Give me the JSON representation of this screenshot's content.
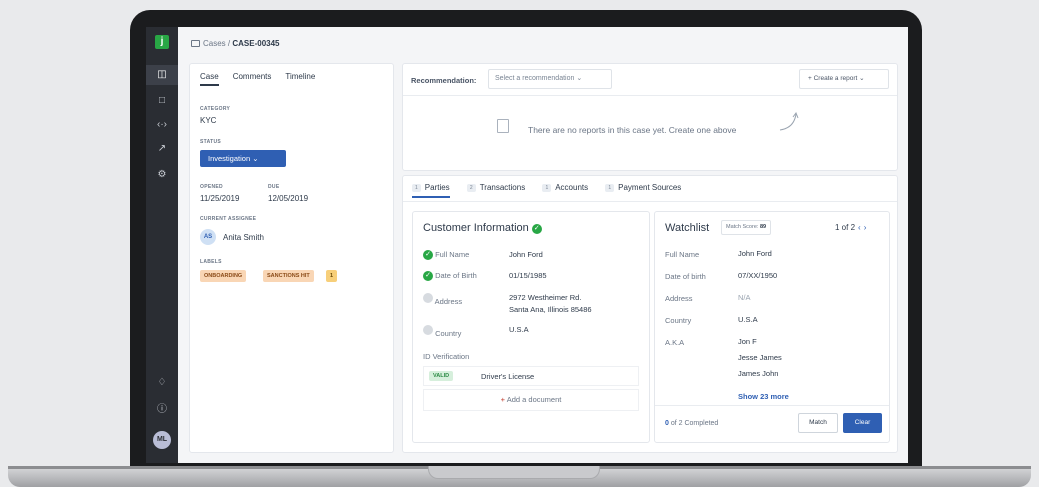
{
  "app": {
    "logo": "j",
    "breadcrumb_parent": "Cases",
    "breadcrumb_sep": " / ",
    "breadcrumb_current": "CASE-00345",
    "user_initials": "ML"
  },
  "left_panel": {
    "tabs": [
      "Case",
      "Comments",
      "Timeline"
    ],
    "category_label": "CATEGORY",
    "category_value": "KYC",
    "status_label": "STATUS",
    "status_value": "Investigation",
    "opened_label": "OPENED",
    "opened_value": "11/25/2019",
    "due_label": "DUE",
    "due_value": "12/05/2019",
    "assignee_label": "CURRENT ASSIGNEE",
    "assignee_initials": "AS",
    "assignee_name": "Anita Smith",
    "labels_label": "LABELS",
    "labels": [
      "ONBOARDING",
      "SANCTIONS HIT"
    ],
    "labels_more": "1"
  },
  "recommendation": {
    "label": "Recommendation:",
    "placeholder": "Select a recommendation",
    "create_report": "Create a report",
    "empty_text": "There are no reports in this case yet. Create one above"
  },
  "subtabs": [
    {
      "count": "1",
      "label": "Parties"
    },
    {
      "count": "2",
      "label": "Transactions"
    },
    {
      "count": "1",
      "label": "Accounts"
    },
    {
      "count": "1",
      "label": "Payment Sources"
    }
  ],
  "customer": {
    "title": "Customer Information",
    "full_name_label": "Full Name",
    "full_name_value": "John Ford",
    "dob_label": "Date of Birth",
    "dob_value": "01/15/1985",
    "address_label": "Address",
    "address_line1": "2972 Westheimer Rd.",
    "address_line2": "Santa Ana, Illinois 85486",
    "country_label": "Country",
    "country_value": "U.S.A",
    "id_verification_label": "ID Verification",
    "id_status": "VALID",
    "id_doc": "Driver's License",
    "add_document": "Add a document"
  },
  "watchlist": {
    "title": "Watchlist",
    "score_label": "Match Score:",
    "score_value": "89",
    "pagination": "1 of 2",
    "full_name_label": "Full Name",
    "full_name_value": "John Ford",
    "dob_label": "Date of birth",
    "dob_value": "07/XX/1950",
    "address_label": "Address",
    "address_value": "N/A",
    "country_label": "Country",
    "country_value": "U.S.A",
    "aka_label": "A.K.A",
    "aka_values": [
      "Jon F",
      "Jesse James",
      "James John"
    ],
    "show_more": "Show 23 more",
    "completed_count": "0",
    "completed_text": " of 2 Completed",
    "match_button": "Match",
    "clear_button": "Clear"
  },
  "colors": {
    "primary": "#2f5fb3",
    "success": "#28a745",
    "rail": "#2a2d33"
  }
}
